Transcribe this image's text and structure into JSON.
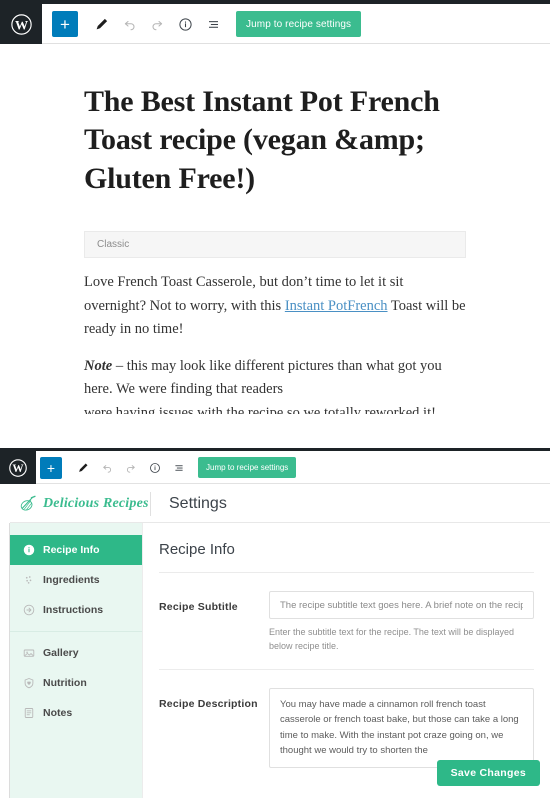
{
  "editor": {
    "wp_logo": "wordpress-logo",
    "toolbar": {
      "add_label": "+",
      "buttons": [
        {
          "name": "add-block-button",
          "icon": "plus-icon",
          "label": "+"
        },
        {
          "name": "tools-button",
          "icon": "pencil-icon",
          "label": ""
        },
        {
          "name": "undo-button",
          "icon": "undo-arrow-icon",
          "label": ""
        },
        {
          "name": "redo-button",
          "icon": "redo-arrow-icon",
          "label": ""
        },
        {
          "name": "details-button",
          "icon": "info-circle-icon",
          "label": ""
        },
        {
          "name": "list-view-button",
          "icon": "list-view-icon",
          "label": ""
        }
      ],
      "jump_label": "Jump to recipe settings"
    },
    "post_title": "The Best Instant Pot French Toast recipe (vegan &amp; Gluten Free!)",
    "classic_block_label": "Classic",
    "paragraph1_before_link": "Love French Toast Casserole, but don’t time to let it sit overnight? Not to worry, with this ",
    "paragraph1_link": "Instant PotFrench",
    "paragraph1_after_link": " Toast will be ready in no time!",
    "paragraph2_note": "Note",
    "paragraph2_rest": " – this may look like different pictures than what got you here. We were finding that readers",
    "paragraph3": "were having issues with the recipe so we totally reworked it! Please give us your feedback in the comments. We welcome constructive comments that will help us serve you better!"
  },
  "settings_panel": {
    "toolbar": {
      "add_label": "+",
      "jump_label": "Jump to recipe settings"
    },
    "brand_name": "Delicious Recipes",
    "brand_icon": "whisk-icon",
    "page_title": "Settings",
    "sidebar": {
      "items": [
        {
          "label": "Recipe Info",
          "icon": "info-circle-icon",
          "active": true
        },
        {
          "label": "Ingredients",
          "icon": "ingredients-icon",
          "active": false
        },
        {
          "label": "Instructions",
          "icon": "instructions-icon",
          "active": false
        },
        {
          "label": "Gallery",
          "icon": "image-icon",
          "active": false
        },
        {
          "label": "Nutrition",
          "icon": "shield-heart-icon",
          "active": false
        },
        {
          "label": "Notes",
          "icon": "notes-icon",
          "active": false
        }
      ]
    },
    "content": {
      "heading": "Recipe Info",
      "fields": [
        {
          "label": "Recipe Subtitle",
          "placeholder": "The recipe subtitle text goes here. A brief note on the recipe",
          "value": "",
          "help": "Enter the subtitle text for the recipe. The text will be displayed below recipe title."
        },
        {
          "label": "Recipe Description",
          "placeholder": "",
          "value": "You may have made a cinnamon roll french toast casserole or french toast bake, but those can take a long time to make. With the instant pot craze going on, we thought we would try to shorten the",
          "help": ""
        }
      ],
      "save_label": "Save Changes"
    }
  },
  "colors": {
    "wp_dark": "#1d2327",
    "wp_blue": "#007cba",
    "brand_green": "#3bbc8f",
    "active_green": "#2eb888",
    "sidebar_bg": "#e9f7f1",
    "link_blue": "#4a90c4"
  }
}
